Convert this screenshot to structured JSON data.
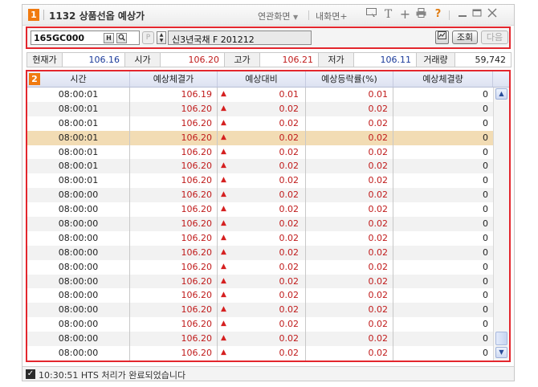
{
  "window": {
    "badge": "1",
    "title": "1132 상품선옵 예상가",
    "menu_related": "연관화면",
    "menu_my": "내화면+",
    "icons": [
      "dropdown-icon",
      "screen-icon",
      "text-size-icon",
      "plus-icon",
      "print-icon",
      "help-icon",
      "minimize-icon",
      "maximize-icon",
      "close-icon"
    ]
  },
  "toolbar": {
    "code": "165GC000",
    "h_label": "H",
    "search_label": "Q",
    "p_label": "P",
    "name": "신3년국채 F 201212",
    "query_label": "조회",
    "next_label": "다음"
  },
  "quote": {
    "current_label": "현재가",
    "current_value": "106.16",
    "open_label": "시가",
    "open_value": "106.20",
    "high_label": "고가",
    "high_value": "106.21",
    "low_label": "저가",
    "low_value": "106.11",
    "volume_label": "거래량",
    "volume_value": "59,742"
  },
  "grid": {
    "badge": "2",
    "headers": [
      "시간",
      "예상체결가",
      "예상대비",
      "예상등락률(%)",
      "예상체결량"
    ],
    "selected_index": 3,
    "rows": [
      {
        "time": "08:00:01",
        "price": "106.19",
        "diff": "0.01",
        "rate": "0.01",
        "volume": "0"
      },
      {
        "time": "08:00:01",
        "price": "106.20",
        "diff": "0.02",
        "rate": "0.02",
        "volume": "0"
      },
      {
        "time": "08:00:01",
        "price": "106.20",
        "diff": "0.02",
        "rate": "0.02",
        "volume": "0"
      },
      {
        "time": "08:00:01",
        "price": "106.20",
        "diff": "0.02",
        "rate": "0.02",
        "volume": "0"
      },
      {
        "time": "08:00:01",
        "price": "106.20",
        "diff": "0.02",
        "rate": "0.02",
        "volume": "0"
      },
      {
        "time": "08:00:01",
        "price": "106.20",
        "diff": "0.02",
        "rate": "0.02",
        "volume": "0"
      },
      {
        "time": "08:00:01",
        "price": "106.20",
        "diff": "0.02",
        "rate": "0.02",
        "volume": "0"
      },
      {
        "time": "08:00:00",
        "price": "106.20",
        "diff": "0.02",
        "rate": "0.02",
        "volume": "0"
      },
      {
        "time": "08:00:00",
        "price": "106.20",
        "diff": "0.02",
        "rate": "0.02",
        "volume": "0"
      },
      {
        "time": "08:00:00",
        "price": "106.20",
        "diff": "0.02",
        "rate": "0.02",
        "volume": "0"
      },
      {
        "time": "08:00:00",
        "price": "106.20",
        "diff": "0.02",
        "rate": "0.02",
        "volume": "0"
      },
      {
        "time": "08:00:00",
        "price": "106.20",
        "diff": "0.02",
        "rate": "0.02",
        "volume": "0"
      },
      {
        "time": "08:00:00",
        "price": "106.20",
        "diff": "0.02",
        "rate": "0.02",
        "volume": "0"
      },
      {
        "time": "08:00:00",
        "price": "106.20",
        "diff": "0.02",
        "rate": "0.02",
        "volume": "0"
      },
      {
        "time": "08:00:00",
        "price": "106.20",
        "diff": "0.02",
        "rate": "0.02",
        "volume": "0"
      },
      {
        "time": "08:00:00",
        "price": "106.20",
        "diff": "0.02",
        "rate": "0.02",
        "volume": "0"
      },
      {
        "time": "08:00:00",
        "price": "106.20",
        "diff": "0.02",
        "rate": "0.02",
        "volume": "0"
      },
      {
        "time": "08:00:00",
        "price": "106.20",
        "diff": "0.02",
        "rate": "0.02",
        "volume": "0"
      },
      {
        "time": "08:00:00",
        "price": "106.20",
        "diff": "0.02",
        "rate": "0.02",
        "volume": "0"
      }
    ]
  },
  "status": {
    "text": "10:30:51  HTS 처리가 완료되었습니다"
  },
  "colors": {
    "accent_red": "#e3262d",
    "badge_orange": "#f07a10",
    "up_red": "#c01b1b",
    "value_blue": "#1a3a9a",
    "selected_row": "#f2dcb4"
  }
}
